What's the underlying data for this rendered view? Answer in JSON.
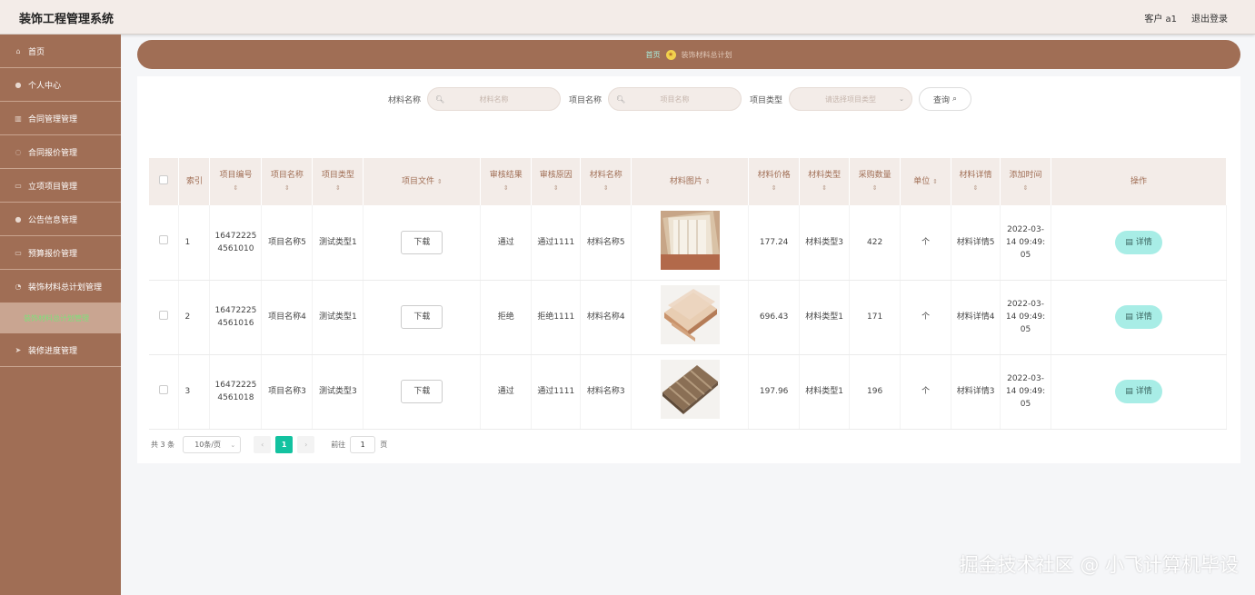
{
  "app": {
    "title": "装饰工程管理系统"
  },
  "header": {
    "user": "客户 a1",
    "logout": "退出登录"
  },
  "sidebar": {
    "items": [
      {
        "label": "首页",
        "icon": "home-icon"
      },
      {
        "label": "个人中心",
        "icon": "user-icon"
      },
      {
        "label": "合同管理管理",
        "icon": "chart-icon"
      },
      {
        "label": "合同报价管理",
        "icon": "lightbulb-icon"
      },
      {
        "label": "立项项目管理",
        "icon": "document-icon"
      },
      {
        "label": "公告信息管理",
        "icon": "user-icon"
      },
      {
        "label": "预算报价管理",
        "icon": "document-icon"
      },
      {
        "label": "装饰材料总计划管理",
        "icon": "chat-icon"
      },
      {
        "label": "装修进度管理",
        "icon": "send-icon"
      }
    ],
    "active_sub": "装饰材料总计划管理"
  },
  "breadcrumb": {
    "home": "首页",
    "current": "装饰材料总计划"
  },
  "search": {
    "material_label": "材料名称",
    "material_placeholder": "材料名称",
    "project_label": "项目名称",
    "project_placeholder": "项目名称",
    "type_label": "项目类型",
    "type_placeholder": "请选择项目类型",
    "query_label": "查询"
  },
  "table": {
    "headers": {
      "index": "索引",
      "project_no": "项目编号",
      "project_name": "项目名称",
      "project_type": "项目类型",
      "project_file": "项目文件",
      "audit_result": "审核结果",
      "audit_reason": "审核原因",
      "material_name": "材料名称",
      "material_image": "材料图片",
      "material_price": "材料价格",
      "material_type": "材料类型",
      "purchase_qty": "采购数量",
      "unit": "单位",
      "material_detail": "材料详情",
      "add_time": "添加时间",
      "actions": "操作"
    },
    "download_label": "下载",
    "detail_label": "详情",
    "rows": [
      {
        "index": "1",
        "project_no_a": "16472225",
        "project_no_b": "4561010",
        "project_name": "项目名称5",
        "project_type": "测试类型1",
        "audit_result": "通过",
        "audit_reason": "通过1111",
        "material_name": "材料名称5",
        "material_price": "177.24",
        "material_type": "材料类型3",
        "purchase_qty": "422",
        "unit": "个",
        "material_detail": "材料详情5",
        "time_a": "2022-03-",
        "time_b": "14 09:49:",
        "time_c": "05"
      },
      {
        "index": "2",
        "project_no_a": "16472225",
        "project_no_b": "4561016",
        "project_name": "项目名称4",
        "project_type": "测试类型1",
        "audit_result": "拒绝",
        "audit_reason": "拒绝1111",
        "material_name": "材料名称4",
        "material_price": "696.43",
        "material_type": "材料类型1",
        "purchase_qty": "171",
        "unit": "个",
        "material_detail": "材料详情4",
        "time_a": "2022-03-",
        "time_b": "14 09:49:",
        "time_c": "05"
      },
      {
        "index": "3",
        "project_no_a": "16472225",
        "project_no_b": "4561018",
        "project_name": "项目名称3",
        "project_type": "测试类型3",
        "audit_result": "通过",
        "audit_reason": "通过1111",
        "material_name": "材料名称3",
        "material_price": "197.96",
        "material_type": "材料类型1",
        "purchase_qty": "196",
        "unit": "个",
        "material_detail": "材料详情3",
        "time_a": "2022-03-",
        "time_b": "14 09:49:",
        "time_c": "05"
      }
    ]
  },
  "pagination": {
    "total": "共 3 条",
    "page_size": "10条/页",
    "current_page": "1",
    "goto_label": "前往",
    "goto_value": "1",
    "page_suffix": "页"
  },
  "watermark": "掘金技术社区 @ 小飞计算机毕设",
  "colors": {
    "primary": "#a06e55",
    "accent": "#13c2a0",
    "detail_button": "#a8ede6"
  }
}
